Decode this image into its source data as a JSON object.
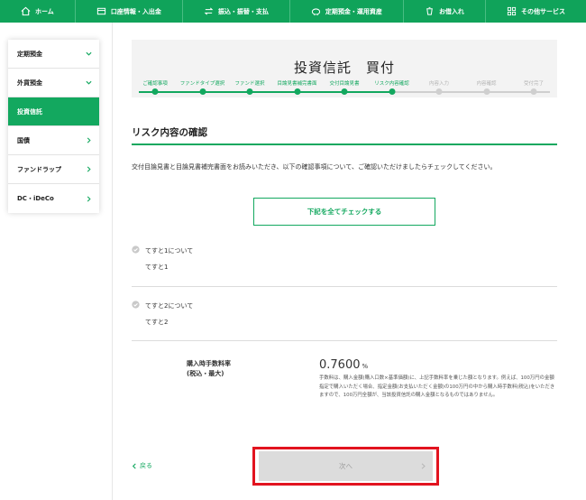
{
  "colors": {
    "brand_green": "#13a85f",
    "nav_green": "#10a35a",
    "highlight_red": "#e2141f",
    "done_step": "#13a85f",
    "pending_step": "#cfcfcf"
  },
  "topnav": [
    {
      "label": "ホーム",
      "icon": "home-icon"
    },
    {
      "label": "口座情報・入出金",
      "icon": "account-icon"
    },
    {
      "label": "振込・振替・支払",
      "icon": "transfer-icon"
    },
    {
      "label": "定期預金・運用資産",
      "icon": "piggy-bank-icon"
    },
    {
      "label": "お借入れ",
      "icon": "loan-icon"
    },
    {
      "label": "その他サービス",
      "icon": "grid-icon"
    }
  ],
  "sidebar": [
    {
      "label": "定期預金",
      "state": "collapsible"
    },
    {
      "label": "外貨預金",
      "state": "collapsible"
    },
    {
      "label": "投資信託",
      "state": "active"
    },
    {
      "label": "国債",
      "state": "link"
    },
    {
      "label": "ファンドラップ",
      "state": "link"
    },
    {
      "label": "DC・iDeCo",
      "state": "link"
    }
  ],
  "page_title": "投資信託　買付",
  "steps": [
    {
      "label": "ご確認事項",
      "done": true
    },
    {
      "label": "ファンドタイプ選択",
      "done": true
    },
    {
      "label": "ファンド選択",
      "done": true
    },
    {
      "label": "目論見書補完書面",
      "done": true
    },
    {
      "label": "交付目論見書",
      "done": true
    },
    {
      "label": "リスク内容確認",
      "done": true
    },
    {
      "label": "内容入力",
      "done": false
    },
    {
      "label": "内容確認",
      "done": false
    },
    {
      "label": "受付完了",
      "done": false
    }
  ],
  "section_title": "リスク内容の確認",
  "intro": "交付目論見書と目論見書補完書面をお読みいただき、以下の確認事項について、ご確認いただけましたらチェックしてください。",
  "check_all_label": "下記を全てチェックする",
  "docs": [
    {
      "title": "てすと1について",
      "link": "てすと1"
    },
    {
      "title": "てすと2について",
      "link": "てすと2"
    }
  ],
  "fee": {
    "label_line1": "購入時手数料率",
    "label_line2": "(税込・最大)",
    "value": "0.7600",
    "unit": "%",
    "note": "手数料は、購入金額(購入口数×基準価額)に、上記手数料率を乗じた額となります。例えば、100万円の金額指定で購入いただく場合、指定金額(お支払いただく金額)の100万円の中から購入時手数料(税込)をいただきますので、100万円全額が、当該投資信託の購入金額となるものではありません。"
  },
  "back_label": "戻る",
  "next_label": "次へ"
}
